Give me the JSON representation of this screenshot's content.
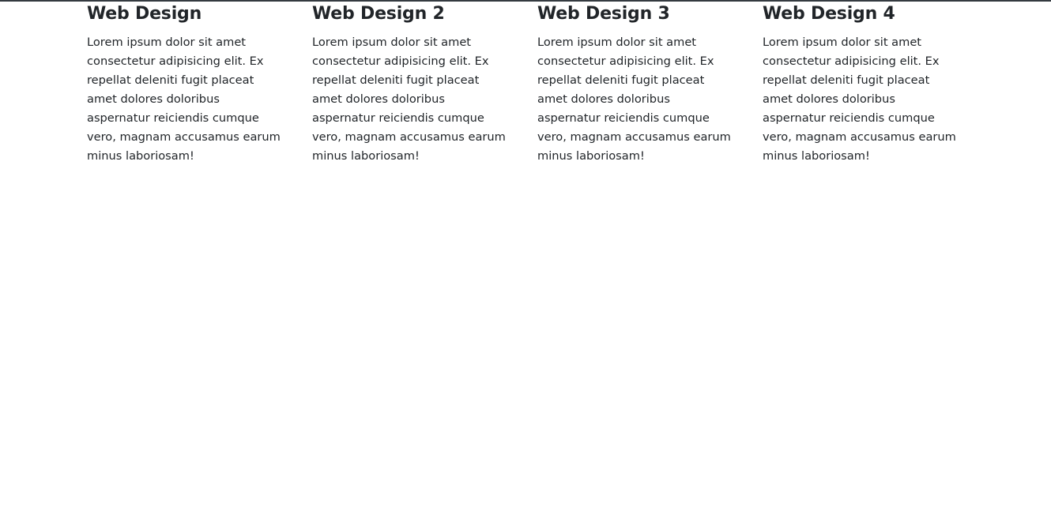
{
  "columns": [
    {
      "title": "Web Design",
      "text": "Lorem ipsum dolor sit amet consectetur adipisicing elit. Ex repellat deleniti fugit placeat amet dolores doloribus aspernatur reiciendis cumque vero, magnam accusamus earum minus laboriosam!"
    },
    {
      "title": "Web Design 2",
      "text": "Lorem ipsum dolor sit amet consectetur adipisicing elit. Ex repellat deleniti fugit placeat amet dolores doloribus aspernatur reiciendis cumque vero, magnam accusamus earum minus laboriosam!"
    },
    {
      "title": "Web Design 3",
      "text": "Lorem ipsum dolor sit amet consectetur adipisicing elit. Ex repellat deleniti fugit placeat amet dolores doloribus aspernatur reiciendis cumque vero, magnam accusamus earum minus laboriosam!"
    },
    {
      "title": "Web Design 4",
      "text": "Lorem ipsum dolor sit amet consectetur adipisicing elit. Ex repellat deleniti fugit placeat amet dolores doloribus aspernatur reiciendis cumque vero, magnam accusamus earum minus laboriosam!"
    }
  ],
  "colors": {
    "text": "#212529",
    "top_rule": "#343a40",
    "background": "#ffffff"
  }
}
